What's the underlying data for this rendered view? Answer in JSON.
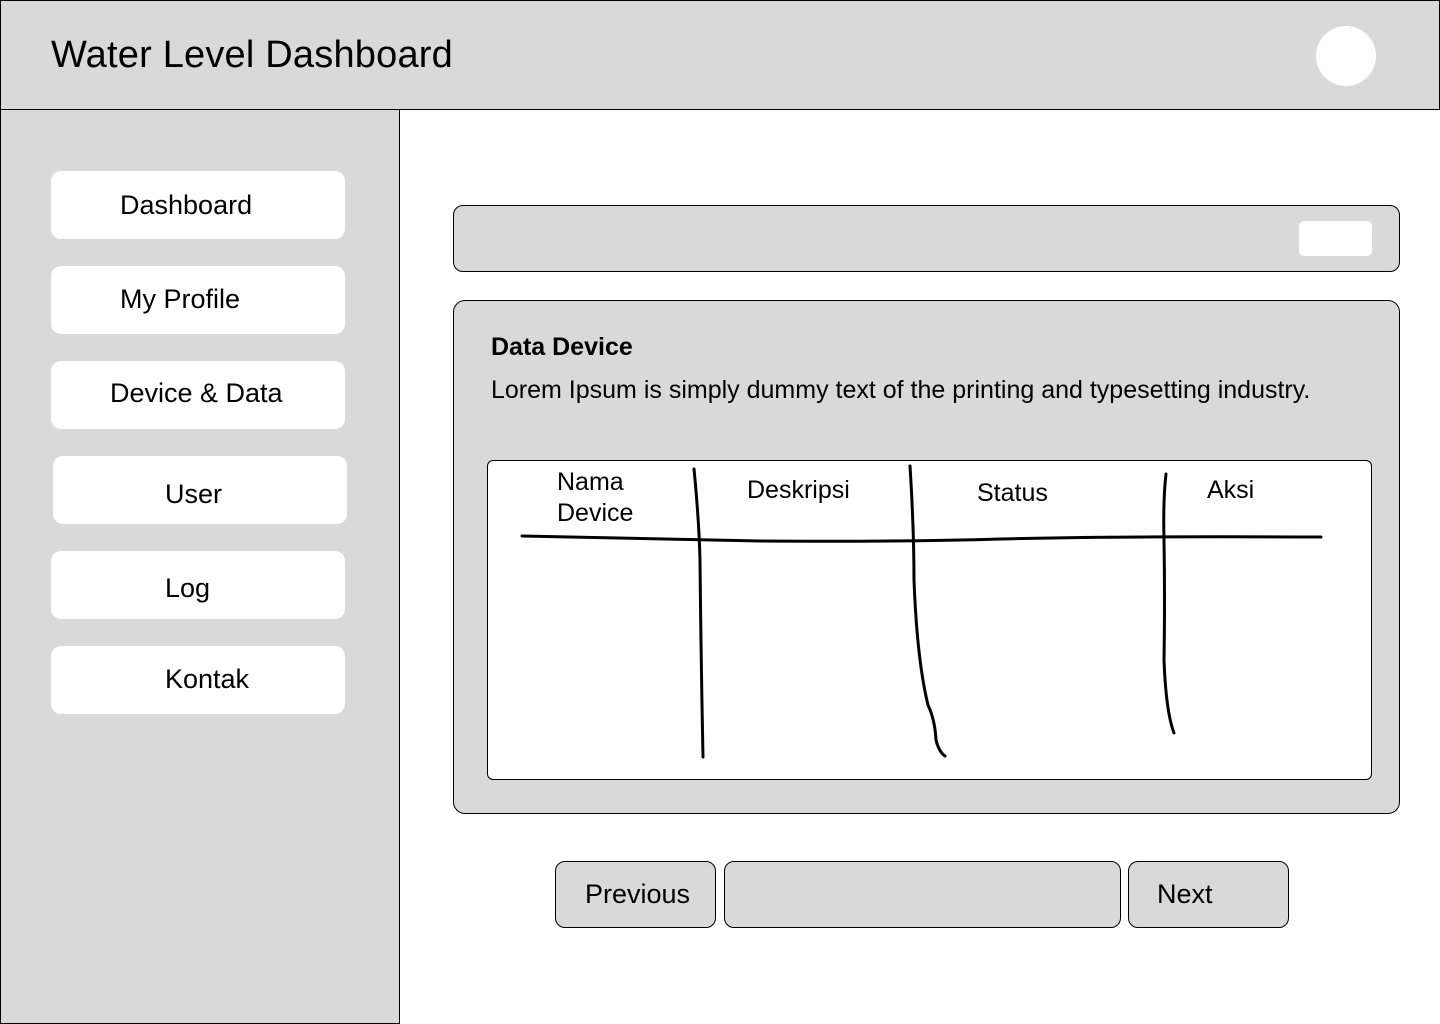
{
  "header": {
    "title": "Water Level Dashboard"
  },
  "sidebar": {
    "items": [
      {
        "label": "Dashboard"
      },
      {
        "label": "My Profile"
      },
      {
        "label": "Device & Data"
      },
      {
        "label": "User"
      },
      {
        "label": "Log"
      },
      {
        "label": "Kontak"
      }
    ]
  },
  "card": {
    "title": "Data Device",
    "description": "Lorem Ipsum is simply dummy text of the printing and typesetting industry.",
    "table": {
      "columns": [
        "Nama Device",
        "Deskripsi",
        "Status",
        "Aksi"
      ],
      "rows": []
    }
  },
  "pagination": {
    "previous_label": "Previous",
    "next_label": "Next"
  },
  "colors": {
    "panel": "#d9d9d9",
    "surface": "#ffffff",
    "border": "#000000"
  }
}
